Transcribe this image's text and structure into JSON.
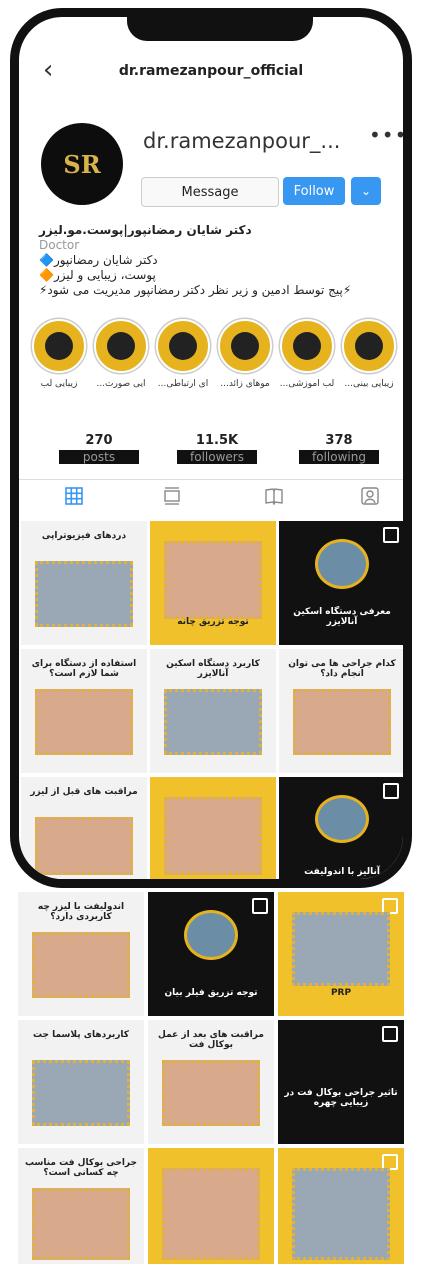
{
  "header": {
    "back_icon": "chevron-left-icon",
    "username": "dr.ramezanpour_official"
  },
  "profile": {
    "handle": "dr.ramezanpour_...",
    "avatar_text": "SR",
    "more": "•••",
    "buttons": {
      "message": "Message",
      "follow": "Follow",
      "dropdown": "⌄"
    },
    "bio": {
      "title": "دکتر شایان رمضانپور|پوست.مو.لیزر",
      "category": "Doctor",
      "line1": "دکتر شایان رمضانپور🔷",
      "line2": "پوست، زیبایی و لیزر🔶",
      "line3": "⚡پیج توسط ادمین و زیر نظر دکتر رمضانپور مدیریت می شود⚡"
    }
  },
  "highlights": [
    {
      "label": "زیبایی لب"
    },
    {
      "label": "...ایی صورت"
    },
    {
      "label": "...ای ارتباطی"
    },
    {
      "label": "...موهای زائد"
    },
    {
      "label": "...لب آموزشی"
    },
    {
      "label": "...زیبایی بینی"
    }
  ],
  "stats": {
    "posts": {
      "value": "270",
      "label": "posts"
    },
    "followers": {
      "value": "11.5K",
      "label": "followers"
    },
    "following": {
      "value": "378",
      "label": "following"
    }
  },
  "tabs": {
    "grid": "grid-icon",
    "feed": "feed-icon",
    "guide": "guide-icon",
    "tagged": "tagged-icon"
  },
  "posts": [
    {
      "title": "دردهای فیزیوتراپی",
      "caption": ""
    },
    {
      "title": "",
      "caption": "توجه تزریق چانه"
    },
    {
      "title": "",
      "caption": "معرفی دستگاه اسکین آنالایزر"
    },
    {
      "title": "استفاده از دستگاه برای شما لازم است؟",
      "caption": ""
    },
    {
      "title": "کاربرد دستگاه اسکین آنالایزر",
      "caption": ""
    },
    {
      "title": "کدام جراحی ها می توان انجام داد؟",
      "caption": ""
    },
    {
      "title": "مراقبت های قبل از لیزر",
      "caption": ""
    },
    {
      "title": "",
      "caption": ""
    },
    {
      "title": "",
      "caption": "آنالیز با اندولیفت"
    },
    {
      "title": "اندولیفت با لیزر چه کاربردی دارد؟",
      "caption": ""
    },
    {
      "title": "",
      "caption": "توجه تزریق فیلر بیان"
    },
    {
      "title": "",
      "caption": "PRP"
    },
    {
      "title": "کاربردهای پلاسما جت",
      "caption": ""
    },
    {
      "title": "مراقبت های بعد از عمل بوکال فت",
      "caption": ""
    },
    {
      "title": "",
      "caption": "تاثیر جراحی بوکال فت در زیبایی چهره"
    },
    {
      "title": "جراحی بوکال فت مناسب چه کسانی است؟",
      "caption": ""
    },
    {
      "title": "",
      "caption": ""
    },
    {
      "title": "",
      "caption": ""
    }
  ]
}
